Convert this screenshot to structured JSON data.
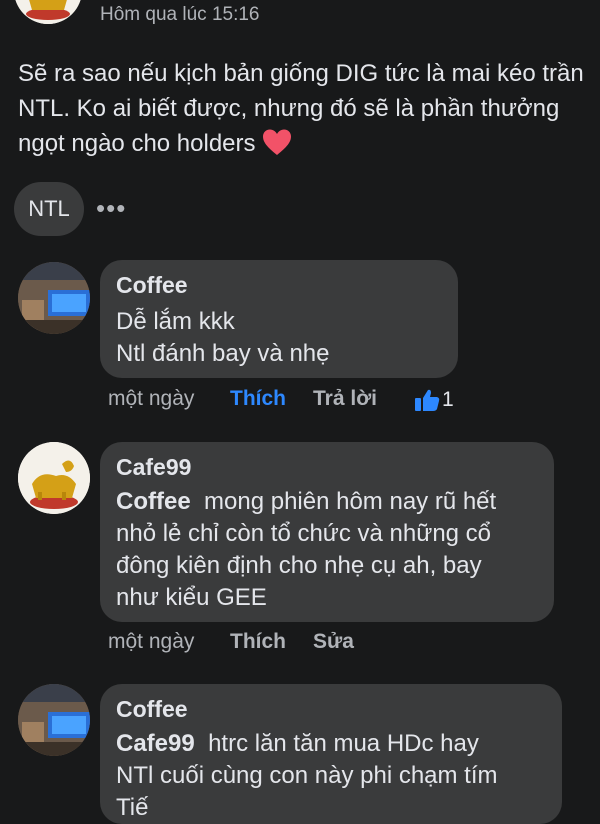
{
  "post": {
    "time": "Hôm qua lúc 15:16",
    "text": "Sẽ ra sao nếu kịch bản giống DIG tức là mai kéo trần NTL. Ko ai biết được, nhưng đó sẽ là phần thưởng ngọt ngào cho holders",
    "emoji": "heart-emoji"
  },
  "tag_chip": "NTL",
  "more_options": "•••",
  "comments": [
    {
      "name": "Coffee",
      "mention": "",
      "lines": [
        "Dễ lắm kkk",
        "Ntl đánh bay và nhẹ"
      ],
      "time": "một ngày",
      "like": "Thích",
      "reply": "Trả lời",
      "reactions": "1"
    },
    {
      "name": "Cafe99",
      "mention": "Coffee",
      "lines": [
        "mong phiên hôm nay rũ hết",
        "nhỏ lẻ chỉ còn tổ chức và những cổ",
        "đông kiên định cho nhẹ cụ ah, bay",
        "như kiểu GEE"
      ],
      "time": "một ngày",
      "like": "Thích",
      "edit": "Sửa"
    },
    {
      "name": "Coffee",
      "mention": "Cafe99",
      "lines": [
        "htrc lăn tăn mua HDc hay",
        "NTl cuối cùng con này phi chạm tím",
        "Tiế"
      ]
    }
  ],
  "colors": {
    "background": "#18191a",
    "bubble": "#3a3b3c",
    "like_active": "#2d88ff",
    "heart": "#f25268"
  }
}
